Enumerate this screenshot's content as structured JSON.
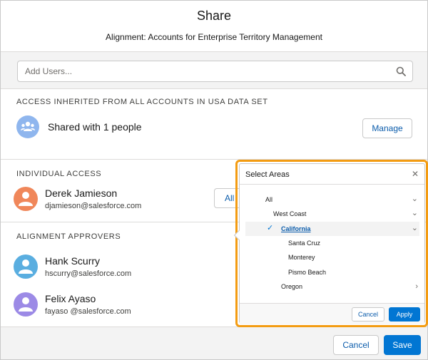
{
  "header": {
    "title": "Share",
    "subtitle": "Alignment: Accounts for Enterprise Territory Management"
  },
  "search": {
    "placeholder": "Add Users..."
  },
  "inherited": {
    "section_label": "ACCESS INHERITED FROM ALL ACCOUNTS IN USA DATA SET",
    "text": "Shared with 1 people",
    "manage_label": "Manage",
    "icon": "group-icon"
  },
  "individual": {
    "section_label": "INDIVIDUAL ACCESS",
    "person": {
      "name": "Derek Jamieson",
      "email": "djamieson@salesforce.com",
      "avatar_color": "#f0875a"
    },
    "access_label": "All"
  },
  "approvers": {
    "section_label": "ALIGNMENT APPROVERS",
    "people": [
      {
        "name": "Hank Scurry",
        "email": "hscurry@salesforce.com",
        "avatar_color": "#5aaee0"
      },
      {
        "name": "Felix Ayaso",
        "email": "fayaso @salesforce.com",
        "avatar_color": "#9c8ae6"
      }
    ]
  },
  "popover": {
    "title": "Select Areas",
    "close_icon": "close-icon",
    "items": [
      {
        "label": "All",
        "chevron": "down"
      },
      {
        "label": "West Coast",
        "chevron": "down"
      },
      {
        "label": "California",
        "chevron": "down",
        "selected": true
      },
      {
        "label": "Santa Cruz"
      },
      {
        "label": "Monterey"
      },
      {
        "label": "Pismo Beach"
      },
      {
        "label": "Oregon",
        "chevron": "right"
      }
    ],
    "cancel_label": "Cancel",
    "apply_label": "Apply"
  },
  "footer": {
    "cancel_label": "Cancel",
    "save_label": "Save"
  },
  "colors": {
    "brand": "#0176d3",
    "link": "#0b5cab",
    "highlight": "#f39c12"
  }
}
